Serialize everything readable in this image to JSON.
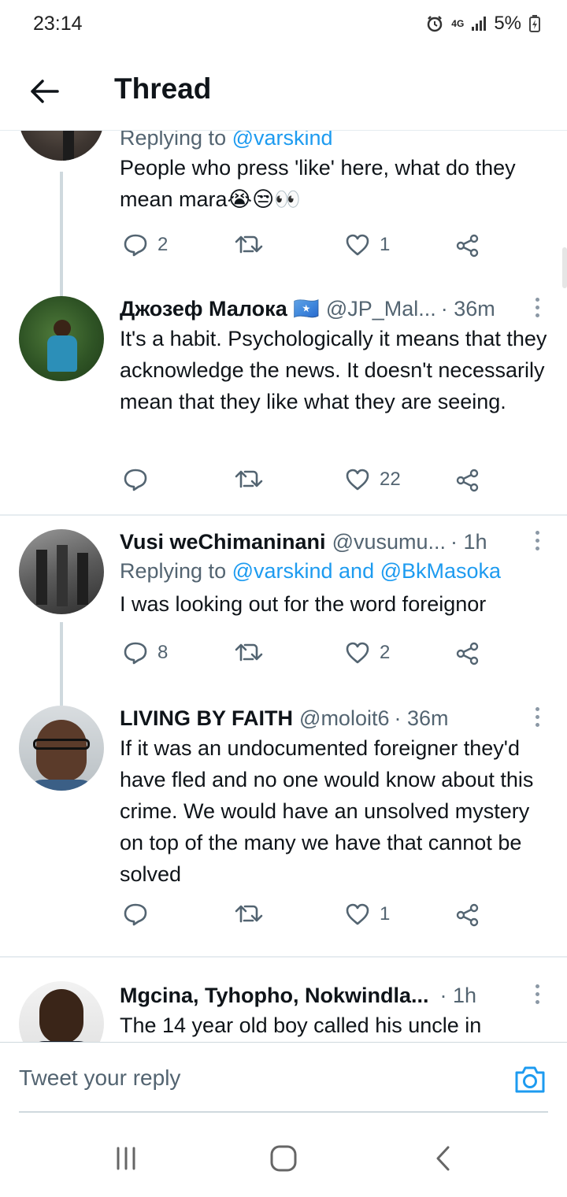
{
  "status_bar": {
    "time": "23:14",
    "network": "4G",
    "battery": "5%"
  },
  "header": {
    "title": "Thread"
  },
  "tweets": [
    {
      "replying_prefix": "Replying to ",
      "replying_to": "@varskind",
      "text": "People who press 'like' here, what do they mean mara😭😒👀",
      "replies": "2",
      "retweets": "",
      "likes": "1"
    },
    {
      "name": "Джозеф Малока 🇸🇴",
      "handle": "@JP_Mal...",
      "time": "· 36m",
      "text": "It's a habit. Psychologically it means that they acknowledge the news. It doesn't necessarily mean that they like what they are seeing.",
      "replies": "",
      "retweets": "",
      "likes": "22"
    },
    {
      "name": "Vusi weChimaninani",
      "handle": "@vusumu...",
      "time": "· 1h",
      "replying_prefix": "Replying to ",
      "replying_to": "@varskind and @BkMasoka",
      "text": "I was looking out for the word foreignor",
      "replies": "8",
      "retweets": "",
      "likes": "2"
    },
    {
      "name": "LIVING BY FAITH",
      "handle": "@moloit6",
      "time": "· 36m",
      "text": "If it was an undocumented foreigner they'd have fled and no one would know about this crime. We would have an unsolved mystery on top of the many we have that cannot be solved",
      "replies": "",
      "retweets": "",
      "likes": "1"
    },
    {
      "name": "Mgcina, Tyhopho, Nokwindla...",
      "handle": "",
      "time": "· 1h",
      "text": "The 14 year old boy called his uncle in"
    }
  ],
  "reply_box": {
    "placeholder": "Tweet your reply"
  },
  "colors": {
    "accent": "#1d9bf0",
    "text": "#0f1419",
    "secondary": "#536471",
    "divider": "#e6ecf0"
  },
  "icons": [
    "back-arrow-icon",
    "reply-icon",
    "retweet-icon",
    "like-icon",
    "share-icon",
    "more-icon",
    "camera-icon",
    "recents-icon",
    "home-icon",
    "back-icon"
  ]
}
